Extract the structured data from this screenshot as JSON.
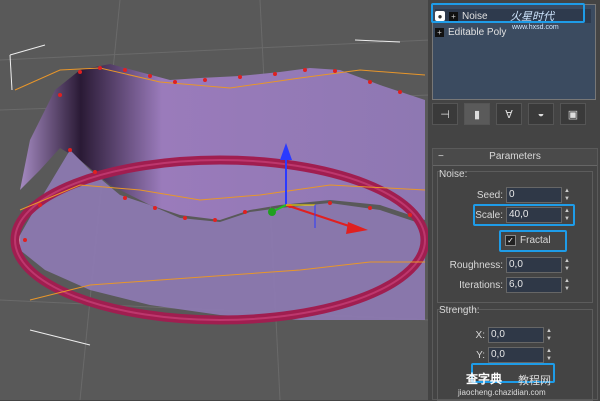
{
  "stack": {
    "items": [
      {
        "label": "Noise"
      },
      {
        "label": "Editable Poly"
      }
    ]
  },
  "watermark": {
    "brand": "火星时代",
    "url": "www.hxsd.com"
  },
  "toolbar": {
    "icons": [
      "pin-stack-icon",
      "show-end-result-icon",
      "make-unique-icon",
      "remove-modifier-icon",
      "configure-sets-icon"
    ]
  },
  "parameters": {
    "title": "Parameters",
    "noise_group": "Noise:",
    "seed": {
      "label": "Seed:",
      "value": "0"
    },
    "scale": {
      "label": "Scale:",
      "value": "40,0"
    },
    "fractal": {
      "label": "Fractal",
      "checked": true
    },
    "roughness": {
      "label": "Roughness:",
      "value": "0,0"
    },
    "iterations": {
      "label": "Iterations:",
      "value": "6,0"
    },
    "strength_group": "Strength:",
    "x": {
      "label": "X:",
      "value": "0,0"
    },
    "y": {
      "label": "Y:",
      "value": "0,0"
    }
  },
  "footer_watermark": {
    "brand": "查字典",
    "suffix": "教程网",
    "url": "jiaocheng.chazidian.com"
  },
  "colors": {
    "accent": "#1e9ce8",
    "surface": "#8a6fa8",
    "ring": "#a01e50",
    "vertex": "#e02020"
  }
}
